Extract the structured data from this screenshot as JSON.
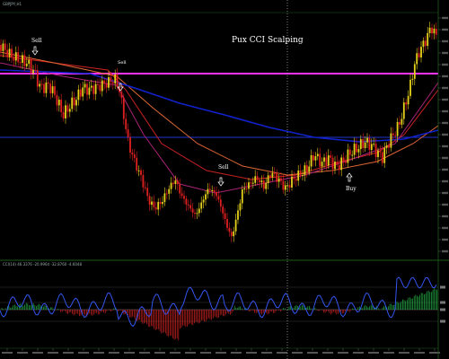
{
  "chart_window": {
    "title": "Pux CCI Scalping",
    "symbol_header": "GBPJPY,H1",
    "indicator_header": "CCI(14) 46.3376 -20.9964 -32.8760 -4.6048"
  },
  "chart_data": [
    {
      "type": "candlestick",
      "title": "Pux CCI Scalping",
      "annotations": [
        {
          "text": "Sell",
          "arrow": "down"
        },
        {
          "text": "Sell",
          "arrow": "down"
        },
        {
          "text": "Sell",
          "arrow": "down"
        },
        {
          "text": "Buy",
          "arrow": "up"
        }
      ],
      "horizontal_levels": [
        {
          "color": "#ff33ff",
          "role": "resistance"
        },
        {
          "color": "#2233cc",
          "role": "support"
        }
      ],
      "moving_average_colors": [
        "#cc2222",
        "#dd6633",
        "#aa2277",
        "#1122cc"
      ],
      "candle_colors": {
        "bull": "#e6d21a",
        "bear": "#e02020"
      }
    },
    {
      "type": "line",
      "name": "CCI",
      "line_color": "#3355ee",
      "histogram_colors": {
        "positive": "#22aa44",
        "negative": "#cc2222"
      },
      "levels_visible": true
    }
  ],
  "colors": {
    "background": "#000000",
    "grid": "#1c5c1c",
    "axis_text": "#9aa0a0"
  }
}
